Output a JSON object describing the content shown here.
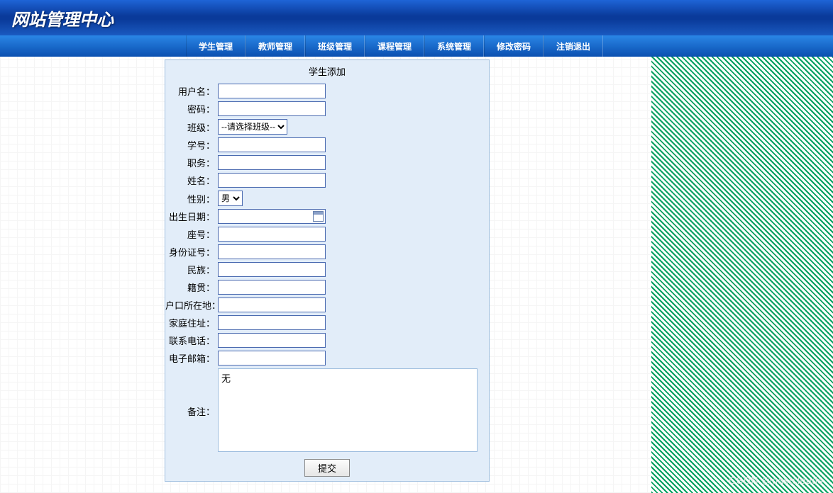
{
  "header": {
    "title": "网站管理中心"
  },
  "nav": {
    "items": [
      "学生管理",
      "教师管理",
      "班级管理",
      "课程管理",
      "系统管理",
      "修改密码",
      "注销退出"
    ]
  },
  "form": {
    "title": "学生添加",
    "labels": {
      "username": "用户名：",
      "password": "密码：",
      "class": "班级：",
      "student_no": "学号：",
      "position": "职务：",
      "name": "姓名：",
      "gender": "性别：",
      "birth": "出生日期：",
      "seat": "座号：",
      "idcard": "身份证号：",
      "ethnic": "民族：",
      "native": "籍贯：",
      "hukou": "户口所在地：",
      "address": "家庭住址：",
      "phone": "联系电话：",
      "email": "电子邮箱：",
      "remark": "备注："
    },
    "class_select_placeholder": "--请选择班级--",
    "gender_selected": "男",
    "remark_value": "无",
    "submit_label": "提交"
  },
  "watermark": "CSDN @pastclouds"
}
